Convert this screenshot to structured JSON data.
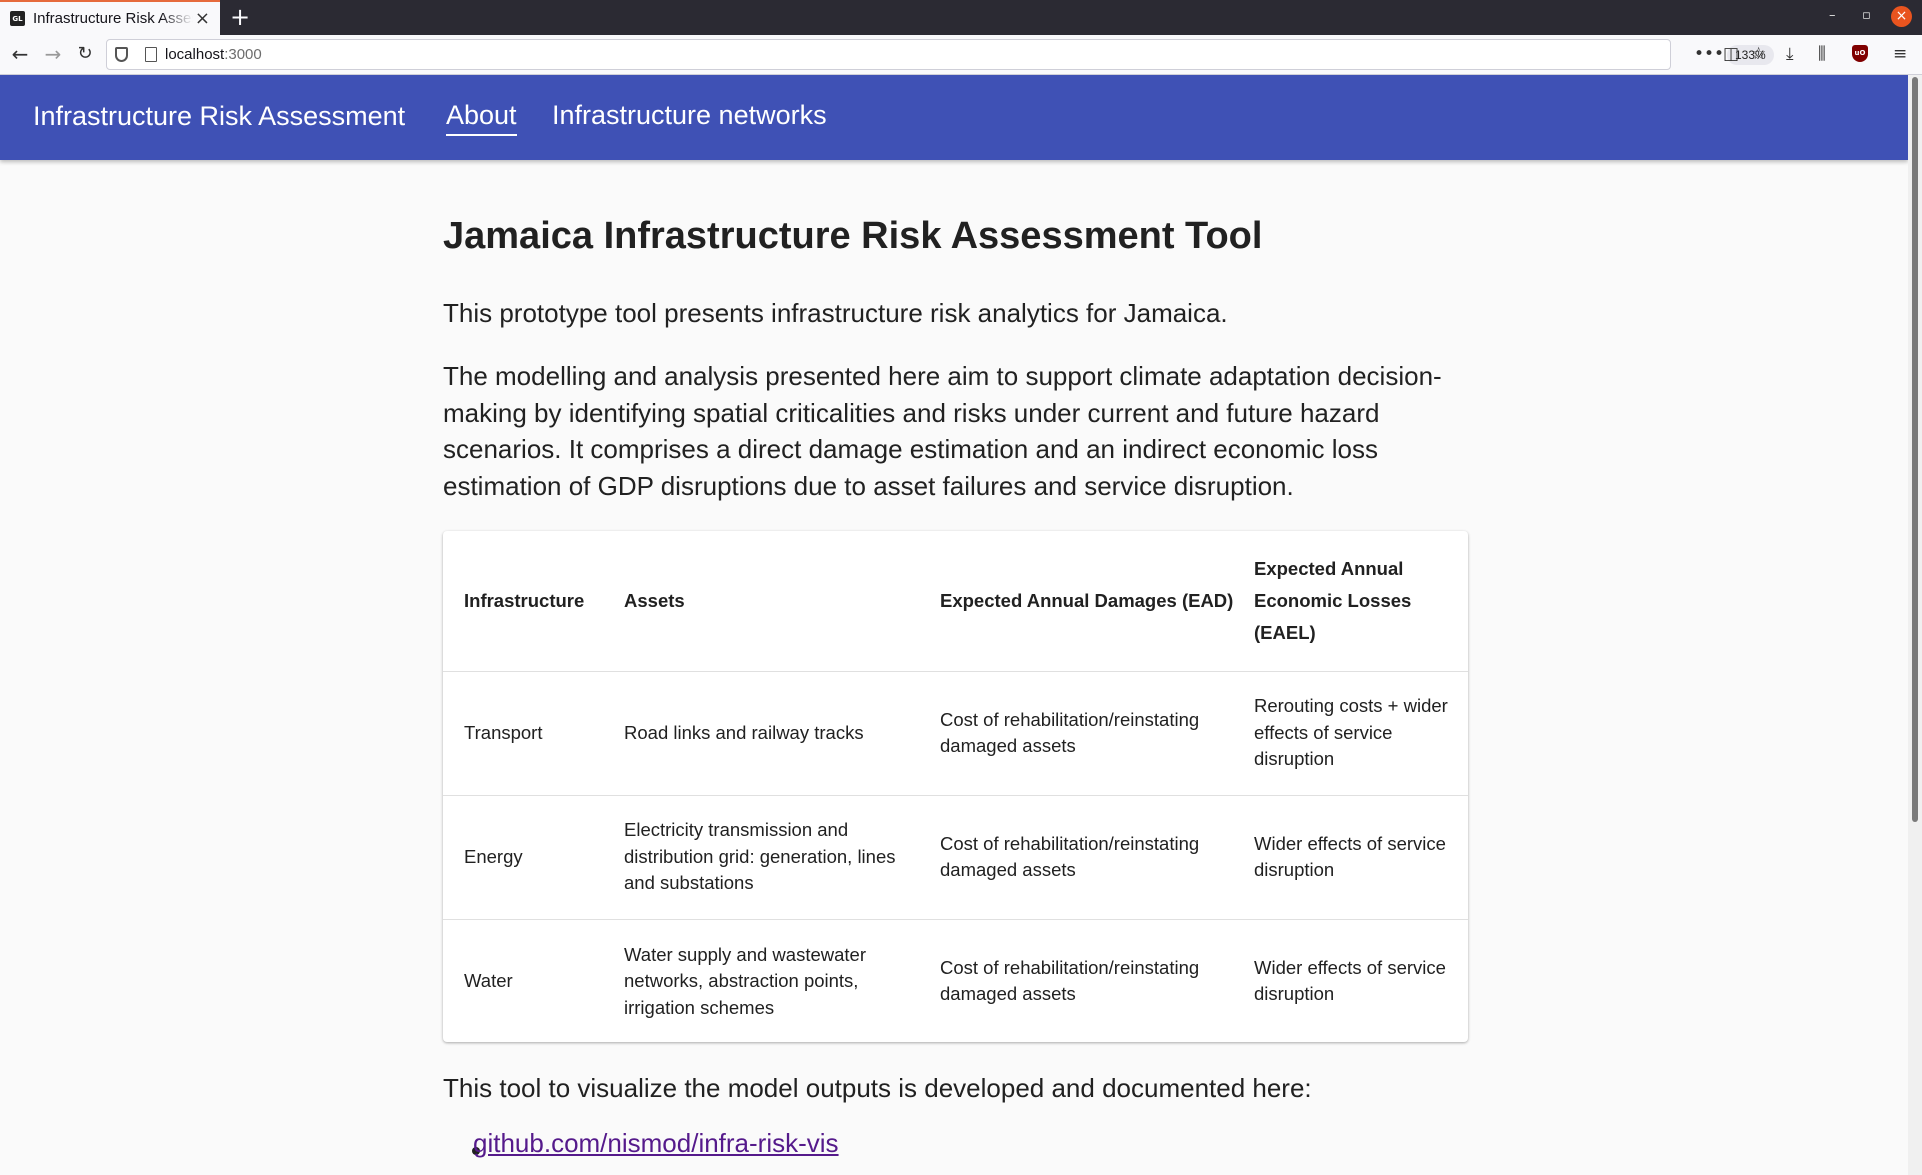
{
  "browser": {
    "tab_title": "Infrastructure Risk Assessment",
    "favicon_text": "GL",
    "url_host": "localhost",
    "url_port": ":3000",
    "zoom": "133%"
  },
  "appbar": {
    "brand": "Infrastructure Risk Assessment",
    "nav": [
      {
        "label": "About",
        "active": true
      },
      {
        "label": "Infrastructure networks",
        "active": false
      }
    ]
  },
  "main": {
    "title": "Jamaica Infrastructure Risk Assessment Tool",
    "intro": "This prototype tool presents infrastructure risk analytics for Jamaica.",
    "description": "The modelling and analysis presented here aim to support climate adaptation decision-making by identifying spatial criticalities and risks under current and future hazard scenarios. It comprises a direct damage estimation and an indirect economic loss estimation of GDP disruptions due to asset failures and service disruption.",
    "table": {
      "headers": [
        "Infrastructure",
        "Assets",
        "Expected Annual Damages (EAD)",
        "Expected Annual Economic Losses (EAEL)"
      ],
      "rows": [
        [
          "Transport",
          "Road links and railway tracks",
          "Cost of rehabilitation/reinstating damaged assets",
          "Rerouting costs + wider effects of service disruption"
        ],
        [
          "Energy",
          "Electricity transmission and distribution grid: generation, lines and substations",
          "Cost of rehabilitation/reinstating damaged assets",
          "Wider effects of service disruption"
        ],
        [
          "Water",
          "Water supply and wastewater networks, abstraction points, irrigation schemes",
          "Cost of rehabilitation/reinstating damaged assets",
          "Wider effects of service disruption"
        ]
      ]
    },
    "outro": "This tool to visualize the model outputs is developed and documented here:",
    "link": "github.com/nismod/infra-risk-vis"
  },
  "colors": {
    "appbar": "#3f51b5",
    "link": "#551a8b",
    "tab_accent": "#e66a3c"
  }
}
